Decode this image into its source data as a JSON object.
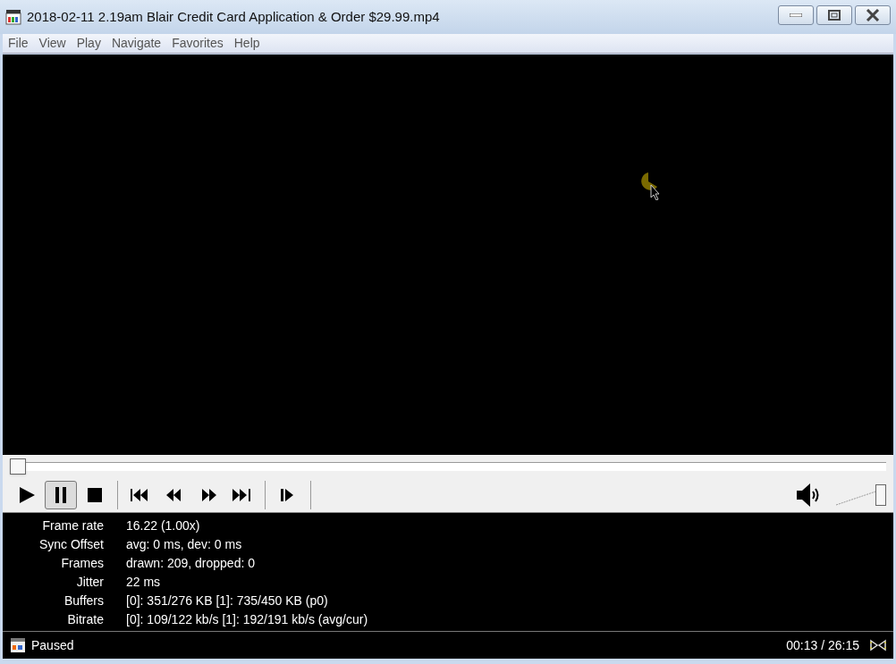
{
  "window": {
    "title": "2018-02-11 2.19am Blair Credit Card Application & Order $29.99.mp4"
  },
  "menu": [
    "File",
    "View",
    "Play",
    "Navigate",
    "Favorites",
    "Help"
  ],
  "seek": {
    "level": 0.0
  },
  "controls": [
    {
      "kind": "play",
      "pressed": false
    },
    {
      "kind": "pause",
      "pressed": true
    },
    {
      "kind": "stop",
      "pressed": false
    },
    {
      "kind": "sep"
    },
    {
      "kind": "prev",
      "pressed": false
    },
    {
      "kind": "rewind",
      "pressed": false
    },
    {
      "kind": "forward",
      "pressed": false
    },
    {
      "kind": "next",
      "pressed": false
    },
    {
      "kind": "sep"
    },
    {
      "kind": "step",
      "pressed": false
    },
    {
      "kind": "sep"
    }
  ],
  "volume": {
    "level": 1.0
  },
  "stats": [
    {
      "label": "Frame rate",
      "value": "16.22 (1.00x)"
    },
    {
      "label": "Sync Offset",
      "value": "avg: 0 ms, dev: 0 ms"
    },
    {
      "label": "Frames",
      "value": "drawn: 209, dropped: 0"
    },
    {
      "label": "Jitter",
      "value": "22 ms"
    },
    {
      "label": "Buffers",
      "value": "[0]: 351/276 KB [1]: 735/450 KB (p0)"
    },
    {
      "label": "Bitrate",
      "value": "[0]: 109/122 kb/s [1]: 192/191 kb/s (avg/cur)"
    }
  ],
  "status_bar": {
    "status": "Paused",
    "time": "00:13 / 26:15"
  }
}
